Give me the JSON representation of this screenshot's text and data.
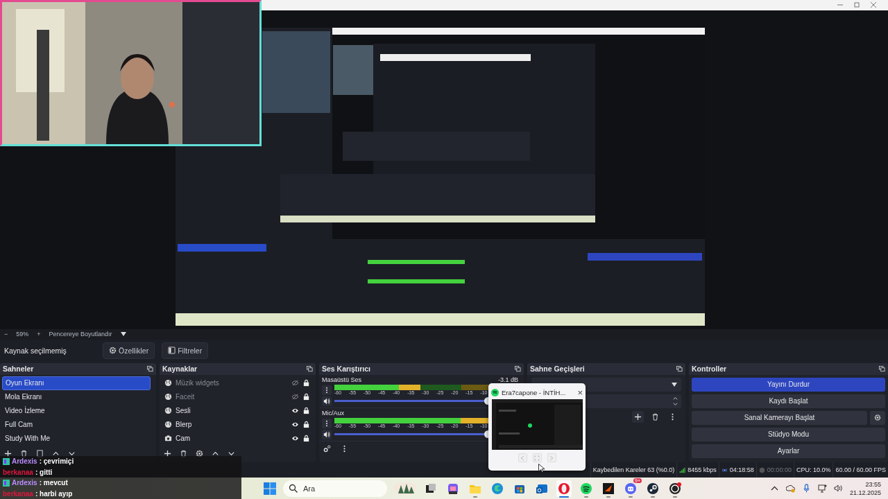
{
  "zoom_bar": {
    "minus": "−",
    "zoom": "59%",
    "plus": "+",
    "fit": "Pencereye Boyutlandır"
  },
  "source_toolbar": {
    "status": "Kaynak seçilmemiş",
    "buttons": [
      {
        "label": "Özellikler",
        "kind": "gear"
      },
      {
        "label": "Filtreler",
        "kind": "filter"
      }
    ]
  },
  "scenes": {
    "title": "Sahneler",
    "items": [
      {
        "label": "Oyun Ekranı",
        "selected": true
      },
      {
        "label": "Mola Ekranı",
        "selected": false
      },
      {
        "label": "Video İzleme",
        "selected": false
      },
      {
        "label": "Full Cam",
        "selected": false
      },
      {
        "label": "Study With Me",
        "selected": false
      }
    ]
  },
  "sources": {
    "title": "Kaynaklar",
    "items": [
      {
        "label": "Müzik widgets",
        "kind": "browser",
        "visible": false,
        "locked": true
      },
      {
        "label": "Faceit",
        "kind": "browser",
        "visible": false,
        "locked": true
      },
      {
        "label": "Sesli",
        "kind": "browser",
        "visible": true,
        "locked": true
      },
      {
        "label": "Blerp",
        "kind": "browser",
        "visible": true,
        "locked": true
      },
      {
        "label": "Cam",
        "kind": "camera",
        "visible": true,
        "locked": true
      }
    ]
  },
  "mixer": {
    "title": "Ses Karıştırıcı",
    "channels": [
      {
        "name": "Masaüstü Ses",
        "reading": "-3.1 dB",
        "meter": {
          "level": 0.46
        },
        "scale": [
          "-60",
          "-55",
          "-50",
          "-45",
          "-40",
          "-35",
          "-30",
          "-25",
          "-20",
          "-15",
          "-10"
        ]
      },
      {
        "name": "Mic/Aux",
        "meter": {
          "level": 0.9
        },
        "scale": [
          "-60",
          "-55",
          "-50",
          "-45",
          "-40",
          "-35",
          "-30",
          "-25",
          "-20",
          "-15",
          "-10"
        ]
      }
    ]
  },
  "transitions": {
    "title": "Sahne Geçişleri"
  },
  "controls": {
    "title": "Kontroller",
    "buttons": [
      {
        "label": "Yayını Durdur",
        "active": true,
        "settings": false
      },
      {
        "label": "Kaydı Başlat",
        "active": false,
        "settings": false
      },
      {
        "label": "Sanal Kamerayı Başlat",
        "active": false,
        "settings": true
      },
      {
        "label": "Stüdyo Modu",
        "active": false,
        "settings": false
      },
      {
        "label": "Ayarlar",
        "active": false,
        "settings": false
      }
    ]
  },
  "status_bar": {
    "dropped": "Kaybedilen Kareler 63 (%0.0)",
    "bitrate": "8455 kbps",
    "stream_time": "04:18:58",
    "record_time": "00:00:00",
    "cpu": "CPU: 10.0%",
    "fps": "60.00 / 60.00 FPS"
  },
  "chat": [
    {
      "user": "Ardexis",
      "message": ": çevrimiçi",
      "color": "#b98cff",
      "badge": true
    },
    {
      "user": "berkanaa",
      "message": ": gitti",
      "color": "#e0163e",
      "badge": false
    },
    {
      "user": "Ardexis",
      "message": ": mevcut",
      "color": "#b98cff",
      "badge": true
    },
    {
      "user": "berkanaa",
      "message": ": harbi ayıp",
      "color": "#e0163e",
      "badge": false
    }
  ],
  "media_popup": {
    "title": "Era7capone - İNTİH...",
    "close": "×"
  },
  "taskbar": {
    "search": {
      "placeholder": "Ara"
    },
    "apps": [
      {
        "kind": "taskview",
        "running": false,
        "active": false
      },
      {
        "kind": "copilot",
        "running": false,
        "active": false
      },
      {
        "kind": "folder",
        "running": true,
        "active": false
      },
      {
        "kind": "edge",
        "running": false,
        "active": false
      },
      {
        "kind": "store",
        "running": false,
        "active": false
      },
      {
        "kind": "mail",
        "running": false,
        "active": false
      },
      {
        "kind": "opera",
        "running": true,
        "active": true
      },
      {
        "kind": "spotify",
        "running": true,
        "active": false
      },
      {
        "kind": "faceit",
        "running": true,
        "active": false
      },
      {
        "kind": "discord",
        "running": true,
        "active": false,
        "badge": "9+"
      },
      {
        "kind": "steam",
        "running": true,
        "active": false
      },
      {
        "kind": "obs",
        "running": true,
        "active": false
      }
    ],
    "time": "23:55",
    "date": "21.12.2025"
  }
}
